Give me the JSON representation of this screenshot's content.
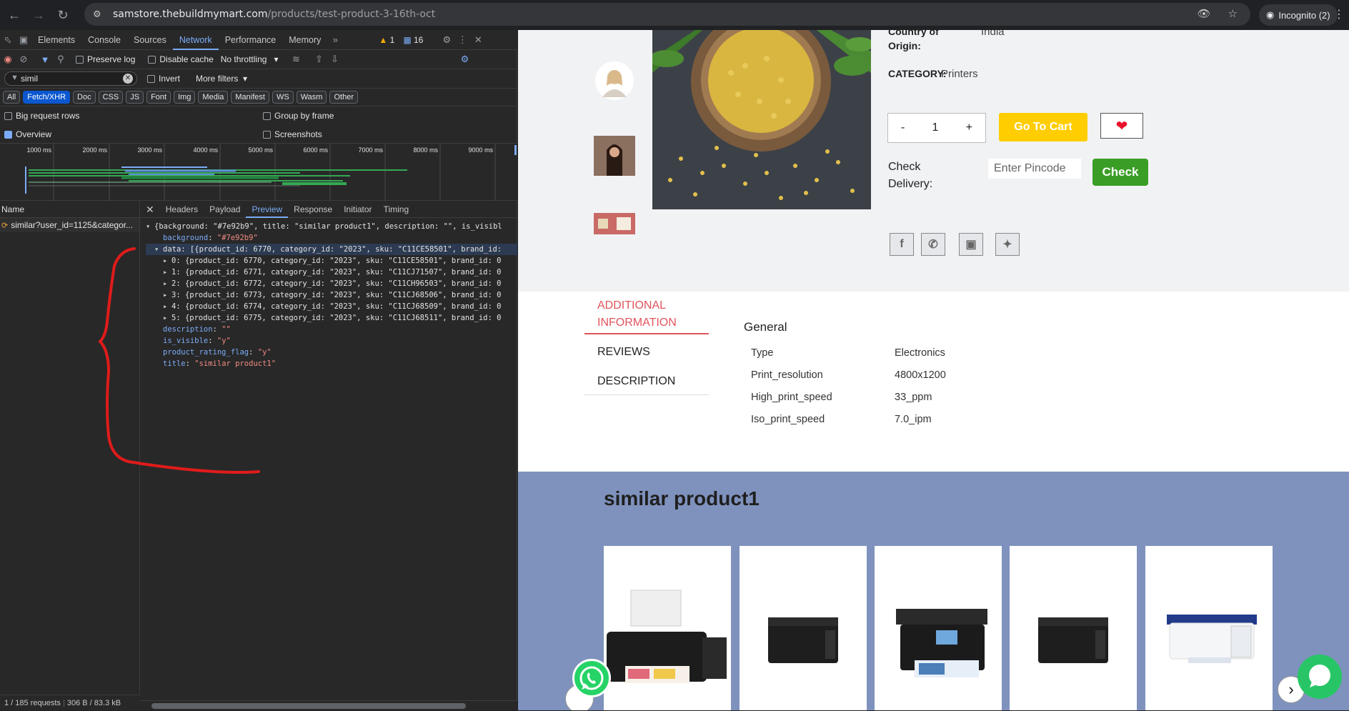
{
  "browser": {
    "url_host": "samstore.thebuildmymart.com",
    "url_path": "/products/test-product-3-16th-oct",
    "incognito_label": "Incognito (2)"
  },
  "devtools": {
    "tabs": [
      "Elements",
      "Console",
      "Sources",
      "Network",
      "Performance",
      "Memory"
    ],
    "active_tab": "Network",
    "warnings_count": "1",
    "messages_count": "16",
    "toolbar": {
      "preserve_log": "Preserve log",
      "disable_cache": "Disable cache",
      "throttling": "No throttling"
    },
    "filter": {
      "value": "simil",
      "invert": "Invert",
      "more_filters": "More filters"
    },
    "type_filters": [
      "All",
      "Fetch/XHR",
      "Doc",
      "CSS",
      "JS",
      "Font",
      "Img",
      "Media",
      "Manifest",
      "WS",
      "Wasm",
      "Other"
    ],
    "active_type": "Fetch/XHR",
    "options": {
      "big_request_rows": "Big request rows",
      "group_by_frame": "Group by frame",
      "overview": "Overview",
      "screenshots": "Screenshots"
    },
    "timeline_ticks": [
      "1000 ms",
      "2000 ms",
      "3000 ms",
      "4000 ms",
      "5000 ms",
      "6000 ms",
      "7000 ms",
      "8000 ms",
      "9000 ms"
    ],
    "name_header": "Name",
    "request_name": "similar?user_id=1125&categor...",
    "status": "1 / 185 requests",
    "transfer": "306 B / 83.3 kB",
    "detail_tabs": [
      "Headers",
      "Payload",
      "Preview",
      "Response",
      "Initiator",
      "Timing"
    ],
    "active_detail_tab": "Preview",
    "preview": {
      "root": "{background: \"#7e92b9\", title: \"similar product1\", description: \"\", is_visibl",
      "background_key": "background",
      "background_val": "\"#7e92b9\"",
      "data_line": "data: [{product_id: 6770, category_id: \"2023\", sku: \"C11CE58501\", brand_id:",
      "items": [
        "0: {product_id: 6770, category_id: \"2023\", sku: \"C11CE58501\", brand_id: 0",
        "1: {product_id: 6771, category_id: \"2023\", sku: \"C11CJ71507\", brand_id: 0",
        "2: {product_id: 6772, category_id: \"2023\", sku: \"C11CH96503\", brand_id: 0",
        "3: {product_id: 6773, category_id: \"2023\", sku: \"C11CJ68506\", brand_id: 0",
        "4: {product_id: 6774, category_id: \"2023\", sku: \"C11CJ68509\", brand_id: 0",
        "5: {product_id: 6775, category_id: \"2023\", sku: \"C11CJ68511\", brand_id: 0"
      ],
      "description_key": "description",
      "description_val": "\"\"",
      "is_visible_key": "is_visible",
      "is_visible_val": "\"y\"",
      "rating_key": "product_rating_flag",
      "rating_val": "\"y\"",
      "title_key": "title",
      "title_val": "\"similar product1\""
    }
  },
  "product": {
    "country_label": "Country of Origin:",
    "country_value": "India",
    "category_label": "CATEGORY:",
    "category_value": "Printers",
    "qty_minus": "-",
    "qty_value": "1",
    "qty_plus": "+",
    "go_to_cart": "Go To Cart",
    "check_delivery_label": "Check Delivery:",
    "pincode_placeholder": "Enter Pincode",
    "check_button": "Check",
    "social": [
      "f",
      "wa",
      "ig",
      "tw"
    ]
  },
  "info": {
    "tabs": [
      "ADDITIONAL INFORMATION",
      "REVIEWS",
      "DESCRIPTION"
    ],
    "active_tab": "ADDITIONAL INFORMATION",
    "section_title": "General",
    "specs": [
      {
        "key": "Type",
        "value": "Electronics"
      },
      {
        "key": "Print_resolution",
        "value": "4800x1200"
      },
      {
        "key": "High_print_speed",
        "value": "33_ppm"
      },
      {
        "key": "Iso_print_speed",
        "value": "7.0_ipm"
      }
    ]
  },
  "similar": {
    "title": "similar product1",
    "background": "#7f92bd"
  },
  "colors": {
    "accent_yellow": "#ffcd00",
    "check_green": "#3a9e26",
    "annotation_red": "#e01b1b",
    "devtools_blue": "#7cacf8"
  }
}
